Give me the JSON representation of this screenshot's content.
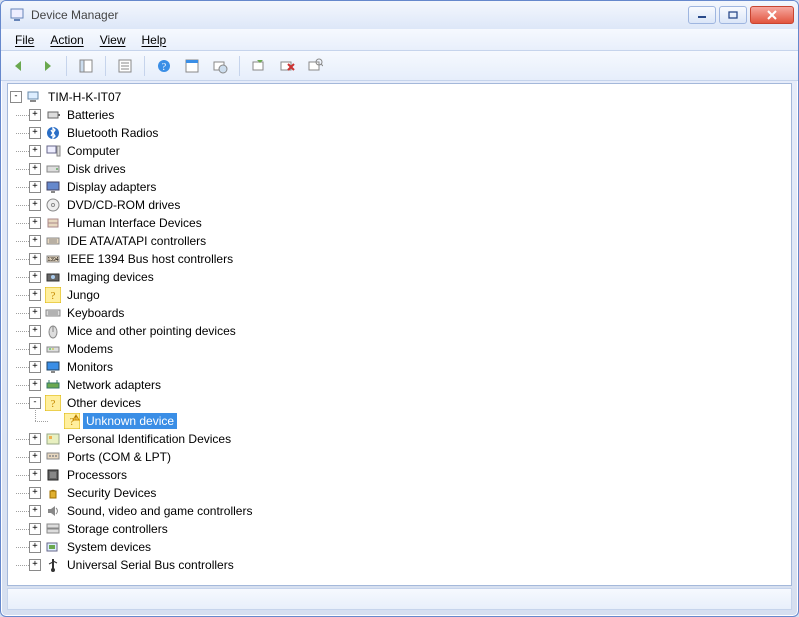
{
  "window": {
    "title": "Device Manager"
  },
  "menu": {
    "file": "File",
    "action": "Action",
    "view": "View",
    "help": "Help"
  },
  "toolbar_icons": [
    "back",
    "forward",
    "|",
    "show-console-tree",
    "|",
    "properties",
    "|",
    "help",
    "refresh",
    "update-driver",
    "|",
    "uninstall",
    "disable",
    "scan-hardware"
  ],
  "root": {
    "name": "TIM-H-K-IT07",
    "icon": "computer",
    "expanded": true,
    "children": [
      {
        "name": "Batteries",
        "icon": "battery"
      },
      {
        "name": "Bluetooth Radios",
        "icon": "bluetooth"
      },
      {
        "name": "Computer",
        "icon": "pc"
      },
      {
        "name": "Disk drives",
        "icon": "disk"
      },
      {
        "name": "Display adapters",
        "icon": "display"
      },
      {
        "name": "DVD/CD-ROM drives",
        "icon": "cd"
      },
      {
        "name": "Human Interface Devices",
        "icon": "hid"
      },
      {
        "name": "IDE ATA/ATAPI controllers",
        "icon": "ide"
      },
      {
        "name": "IEEE 1394 Bus host controllers",
        "icon": "1394"
      },
      {
        "name": "Imaging devices",
        "icon": "imaging"
      },
      {
        "name": "Jungo",
        "icon": "qmark"
      },
      {
        "name": "Keyboards",
        "icon": "keyboard"
      },
      {
        "name": "Mice and other pointing devices",
        "icon": "mouse"
      },
      {
        "name": "Modems",
        "icon": "modem"
      },
      {
        "name": "Monitors",
        "icon": "monitor"
      },
      {
        "name": "Network adapters",
        "icon": "net"
      },
      {
        "name": "Other devices",
        "icon": "qmark",
        "expanded": true,
        "children": [
          {
            "name": "Unknown device",
            "icon": "warn",
            "selected": true,
            "leaf": true
          }
        ]
      },
      {
        "name": "Personal Identification Devices",
        "icon": "pid"
      },
      {
        "name": "Ports (COM & LPT)",
        "icon": "port"
      },
      {
        "name": "Processors",
        "icon": "cpu"
      },
      {
        "name": "Security Devices",
        "icon": "security"
      },
      {
        "name": "Sound, video and game controllers",
        "icon": "sound"
      },
      {
        "name": "Storage controllers",
        "icon": "storage"
      },
      {
        "name": "System devices",
        "icon": "system"
      },
      {
        "name": "Universal Serial Bus controllers",
        "icon": "usb"
      }
    ]
  }
}
